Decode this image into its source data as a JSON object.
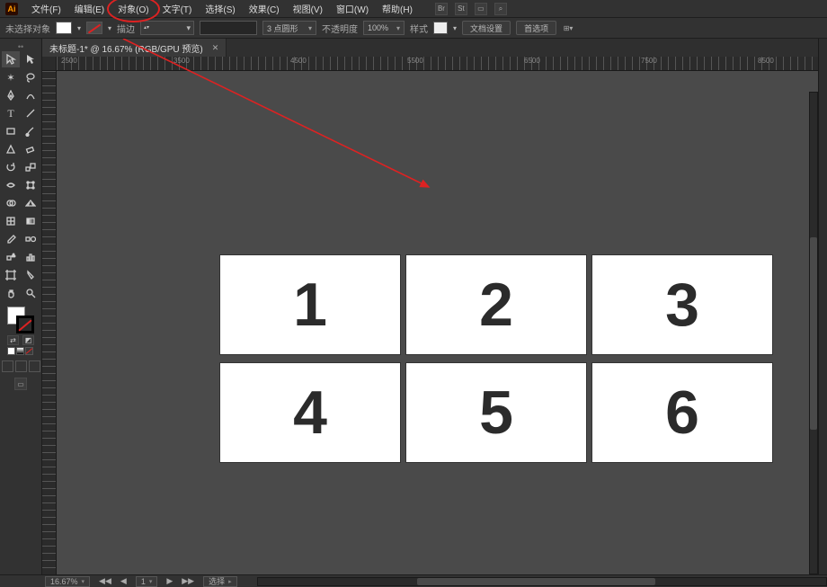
{
  "app": {
    "name_short": "Ai"
  },
  "menu": {
    "items": [
      "文件(F)",
      "编辑(E)",
      "对象(O)",
      "文字(T)",
      "选择(S)",
      "效果(C)",
      "视图(V)",
      "窗口(W)",
      "帮助(H)"
    ],
    "circled_index": 2
  },
  "controlbar": {
    "selection": "未选择对象",
    "stroke_label": "描边",
    "stroke_value": "",
    "brush_preset": "3 点圆形",
    "opacity_label": "不透明度",
    "opacity_value": "100%",
    "style_label": "样式",
    "doc_setup": "文档设置",
    "prefs": "首选项"
  },
  "tab": {
    "label": "未标题-1* @ 16.67% (RGB/GPU 预览)"
  },
  "tools": {
    "left": [
      "selection",
      "direct-select",
      "magic-wand",
      "lasso",
      "pen",
      "curvature",
      "type",
      "line",
      "rectangle",
      "brush",
      "shaper",
      "eraser",
      "rotate",
      "scale",
      "width",
      "free-transform",
      "shape-builder",
      "perspective",
      "mesh",
      "gradient",
      "eyedropper",
      "blend",
      "symbol-spray",
      "graph",
      "artboard",
      "slice",
      "hand",
      "zoom"
    ]
  },
  "artboards": {
    "labels": [
      "1",
      "2",
      "3",
      "4",
      "5",
      "6"
    ]
  },
  "status": {
    "zoom": "16.67%",
    "mode_label": "选择",
    "nav_tool": "▶"
  },
  "ruler": {
    "majors": [
      "2500",
      "3500",
      "4500",
      "5500",
      "6500",
      "7500",
      "8500"
    ]
  }
}
